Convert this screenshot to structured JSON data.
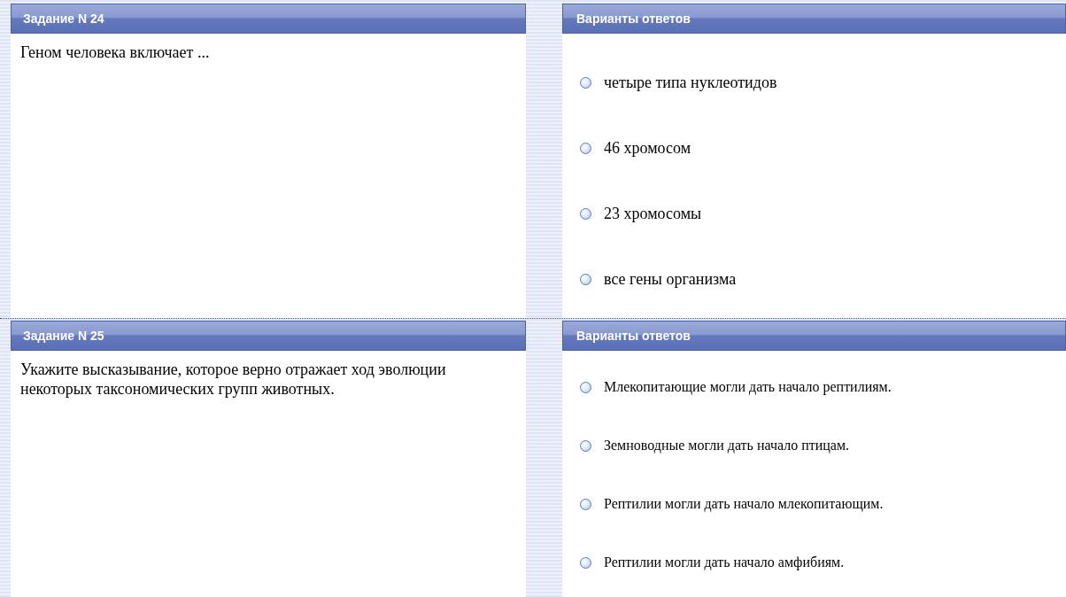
{
  "tasks": [
    {
      "title": "Задание N 24",
      "question": "Геном человека включает ...",
      "answers_title": "Варианты ответов",
      "options": [
        {
          "label": "четыре типа нуклеотидов",
          "selected": false
        },
        {
          "label": "46 хромосом",
          "selected": false
        },
        {
          "label": "23 хромосомы",
          "selected": false
        },
        {
          "label": "все гены организма",
          "selected": false
        }
      ]
    },
    {
      "title": "Задание N 25",
      "question": "Укажите высказывание, которое верно отражает ход эволюции некоторых таксономических групп животных.",
      "answers_title": "Варианты ответов",
      "options": [
        {
          "label": "Млекопитающие могли дать начало рептилиям.",
          "selected": false
        },
        {
          "label": "Земноводные могли дать начало птицам.",
          "selected": false
        },
        {
          "label": "Рептилии могли дать начало млекопитающим.",
          "selected": false
        },
        {
          "label": "Рептилии могли дать начало амфибиям.",
          "selected": false
        }
      ]
    }
  ]
}
